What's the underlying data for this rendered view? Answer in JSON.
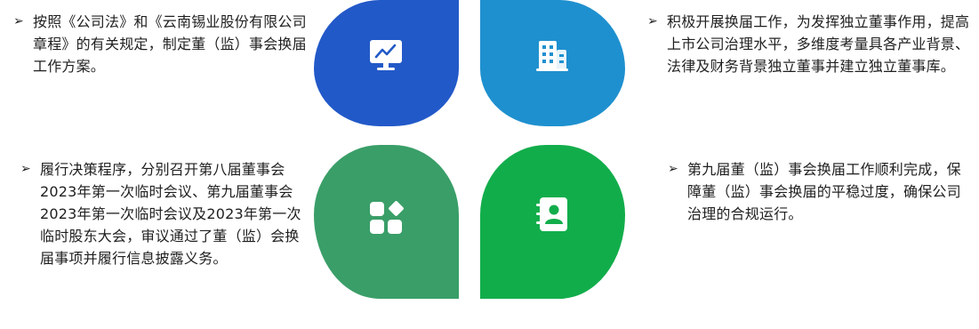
{
  "bullet_glyph": "➢",
  "paragraphs": {
    "top_left": "按照《公司法》和《云南锡业股份有限公司章程》的有关规定，制定董（监）事会换届工作方案。",
    "bottom_left": "履行决策程序，分别召开第八届董事会2023年第一次临时会议、第九届董事会2023年第一次临时会议及2023年第一次临时股东大会，审议通过了董（监）会换届事项并履行信息披露义务。",
    "top_right": "积极开展换届工作，为发挥独立董事作用，提高上市公司治理水平，多维度考量具各产业背景、法律及财务背景独立董事并建立独立董事库。",
    "bottom_right": "第九届董（监）事会换届工作顺利完成，保障董（监）事会换届的平稳过度，确保公司治理的合规运行。"
  },
  "petals": [
    {
      "position": "top-left",
      "color": "#2259c8",
      "icon": "monitor-chart-icon"
    },
    {
      "position": "top-right",
      "color": "#1f90cf",
      "icon": "building-icon"
    },
    {
      "position": "bottom-left",
      "color": "#3a9e68",
      "icon": "apps-grid-icon"
    },
    {
      "position": "bottom-right",
      "color": "#12ad4b",
      "icon": "contact-book-icon"
    }
  ]
}
